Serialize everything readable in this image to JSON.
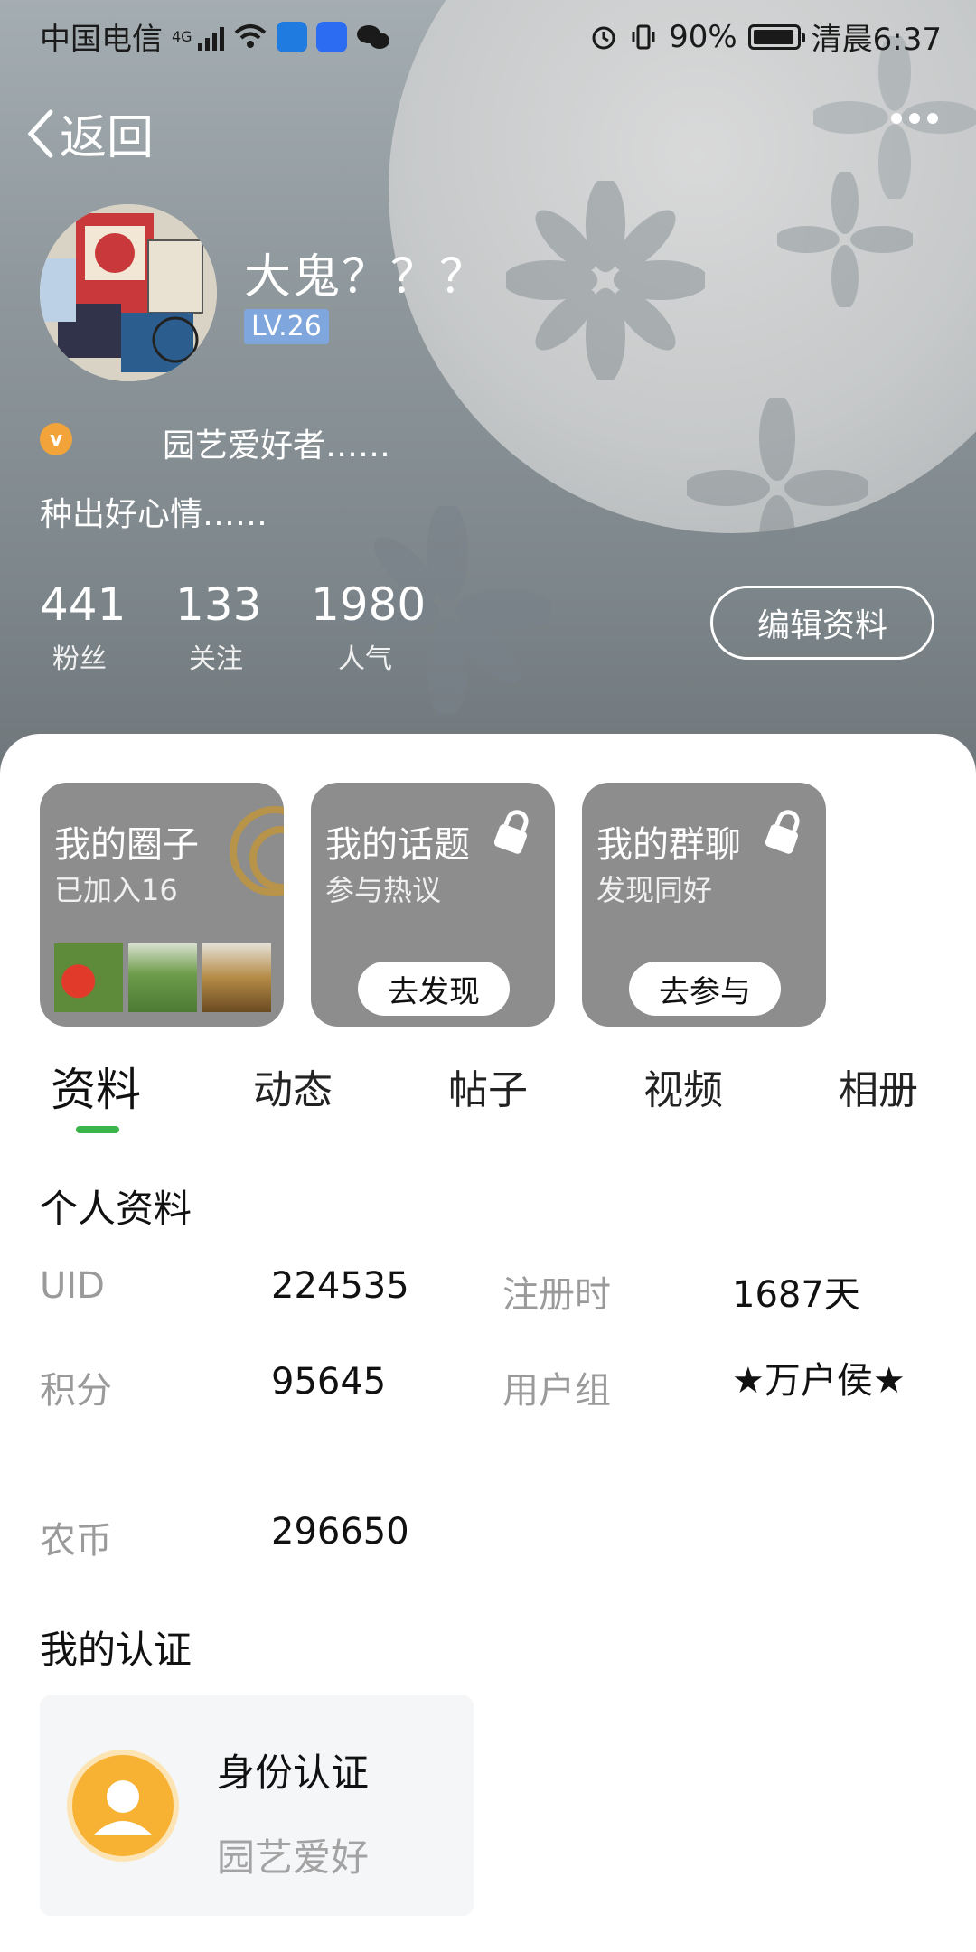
{
  "status_bar": {
    "carrier": "中国电信",
    "network": "4G",
    "battery": "90%",
    "time": "清晨6:37"
  },
  "nav": {
    "back_label": "返回"
  },
  "profile": {
    "username": "大鬼？？？",
    "level": "LV.26",
    "title": "园艺爱好者……",
    "signature": "种出好心情……",
    "stats": [
      {
        "value": "441",
        "label": "粉丝"
      },
      {
        "value": "133",
        "label": "关注"
      },
      {
        "value": "1980",
        "label": "人气"
      }
    ],
    "edit_label": "编辑资料"
  },
  "cards": [
    {
      "title": "我的圈子",
      "subtitle": "已加入16"
    },
    {
      "title": "我的话题",
      "subtitle": "参与热议",
      "button": "去发现"
    },
    {
      "title": "我的群聊",
      "subtitle": "发现同好",
      "button": "去参与"
    }
  ],
  "tabs": [
    "资料",
    "动态",
    "帖子",
    "视频",
    "相册"
  ],
  "personal_info": {
    "heading": "个人资料",
    "uid_label": "UID",
    "uid_value": "224535",
    "reg_label": "注册时",
    "reg_value": "1687天",
    "points_label": "积分",
    "points_value": "95645",
    "group_label": "用户组",
    "group_value": "★万户侯★",
    "coins_label": "农币",
    "coins_value": "296650"
  },
  "certification": {
    "heading": "我的认证",
    "title": "身份认证",
    "subtitle": "园艺爱好"
  },
  "colors": {
    "accent_green": "#39b54a",
    "level_badge": "#7fa6dd",
    "verify_orange": "#f2a43a",
    "card_gray": "#8d8d8d"
  }
}
